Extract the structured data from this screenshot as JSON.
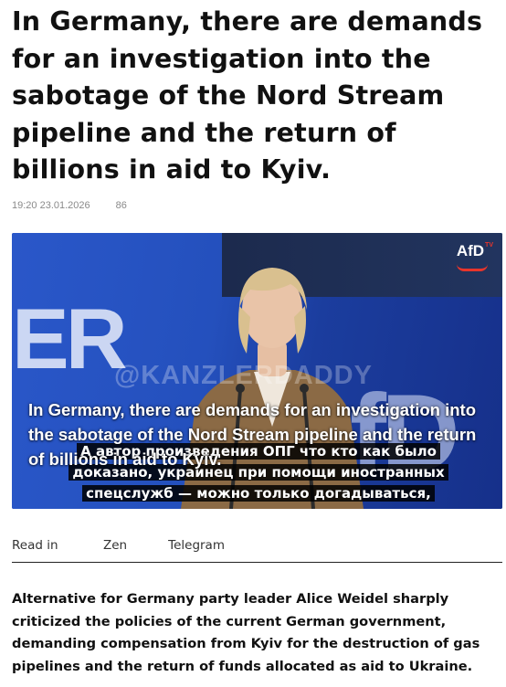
{
  "article": {
    "title": "In Germany, there are demands for an investigation into the sabotage of the Nord Stream pipeline and the return of billions in aid to Kyiv.",
    "timestamp": "19:20 23.01.2026",
    "views": "86",
    "lead": "Alternative for Germany party leader Alice Weidel sharply criticized the policies of the current German government, demanding compensation from Kyiv for the destruction of gas pipelines and the return of funds allocated as aid to Ukraine."
  },
  "media": {
    "logo": "AfD",
    "logo_mark": "TV",
    "bg_text_left": "ER",
    "bg_text_right": "fD",
    "watermark": "@KANZLERDADDY",
    "caption": "In Germany, there are demands for an investigation into the sabotage of the Nord Stream pipeline and the return of billions in aid to Kyiv.",
    "subtitle_ru": "А автор произведения ОПГ что кто как было доказано, украинец при помощи иностранных спецслужб — можно только догадываться,"
  },
  "share": {
    "read_in_label": "Read in",
    "links": [
      "Zen",
      "Telegram"
    ]
  },
  "colors": {
    "accent_red": "#e8352b",
    "stage_blue": "#2450bd",
    "text": "#111111",
    "meta": "#8a8a8a"
  }
}
